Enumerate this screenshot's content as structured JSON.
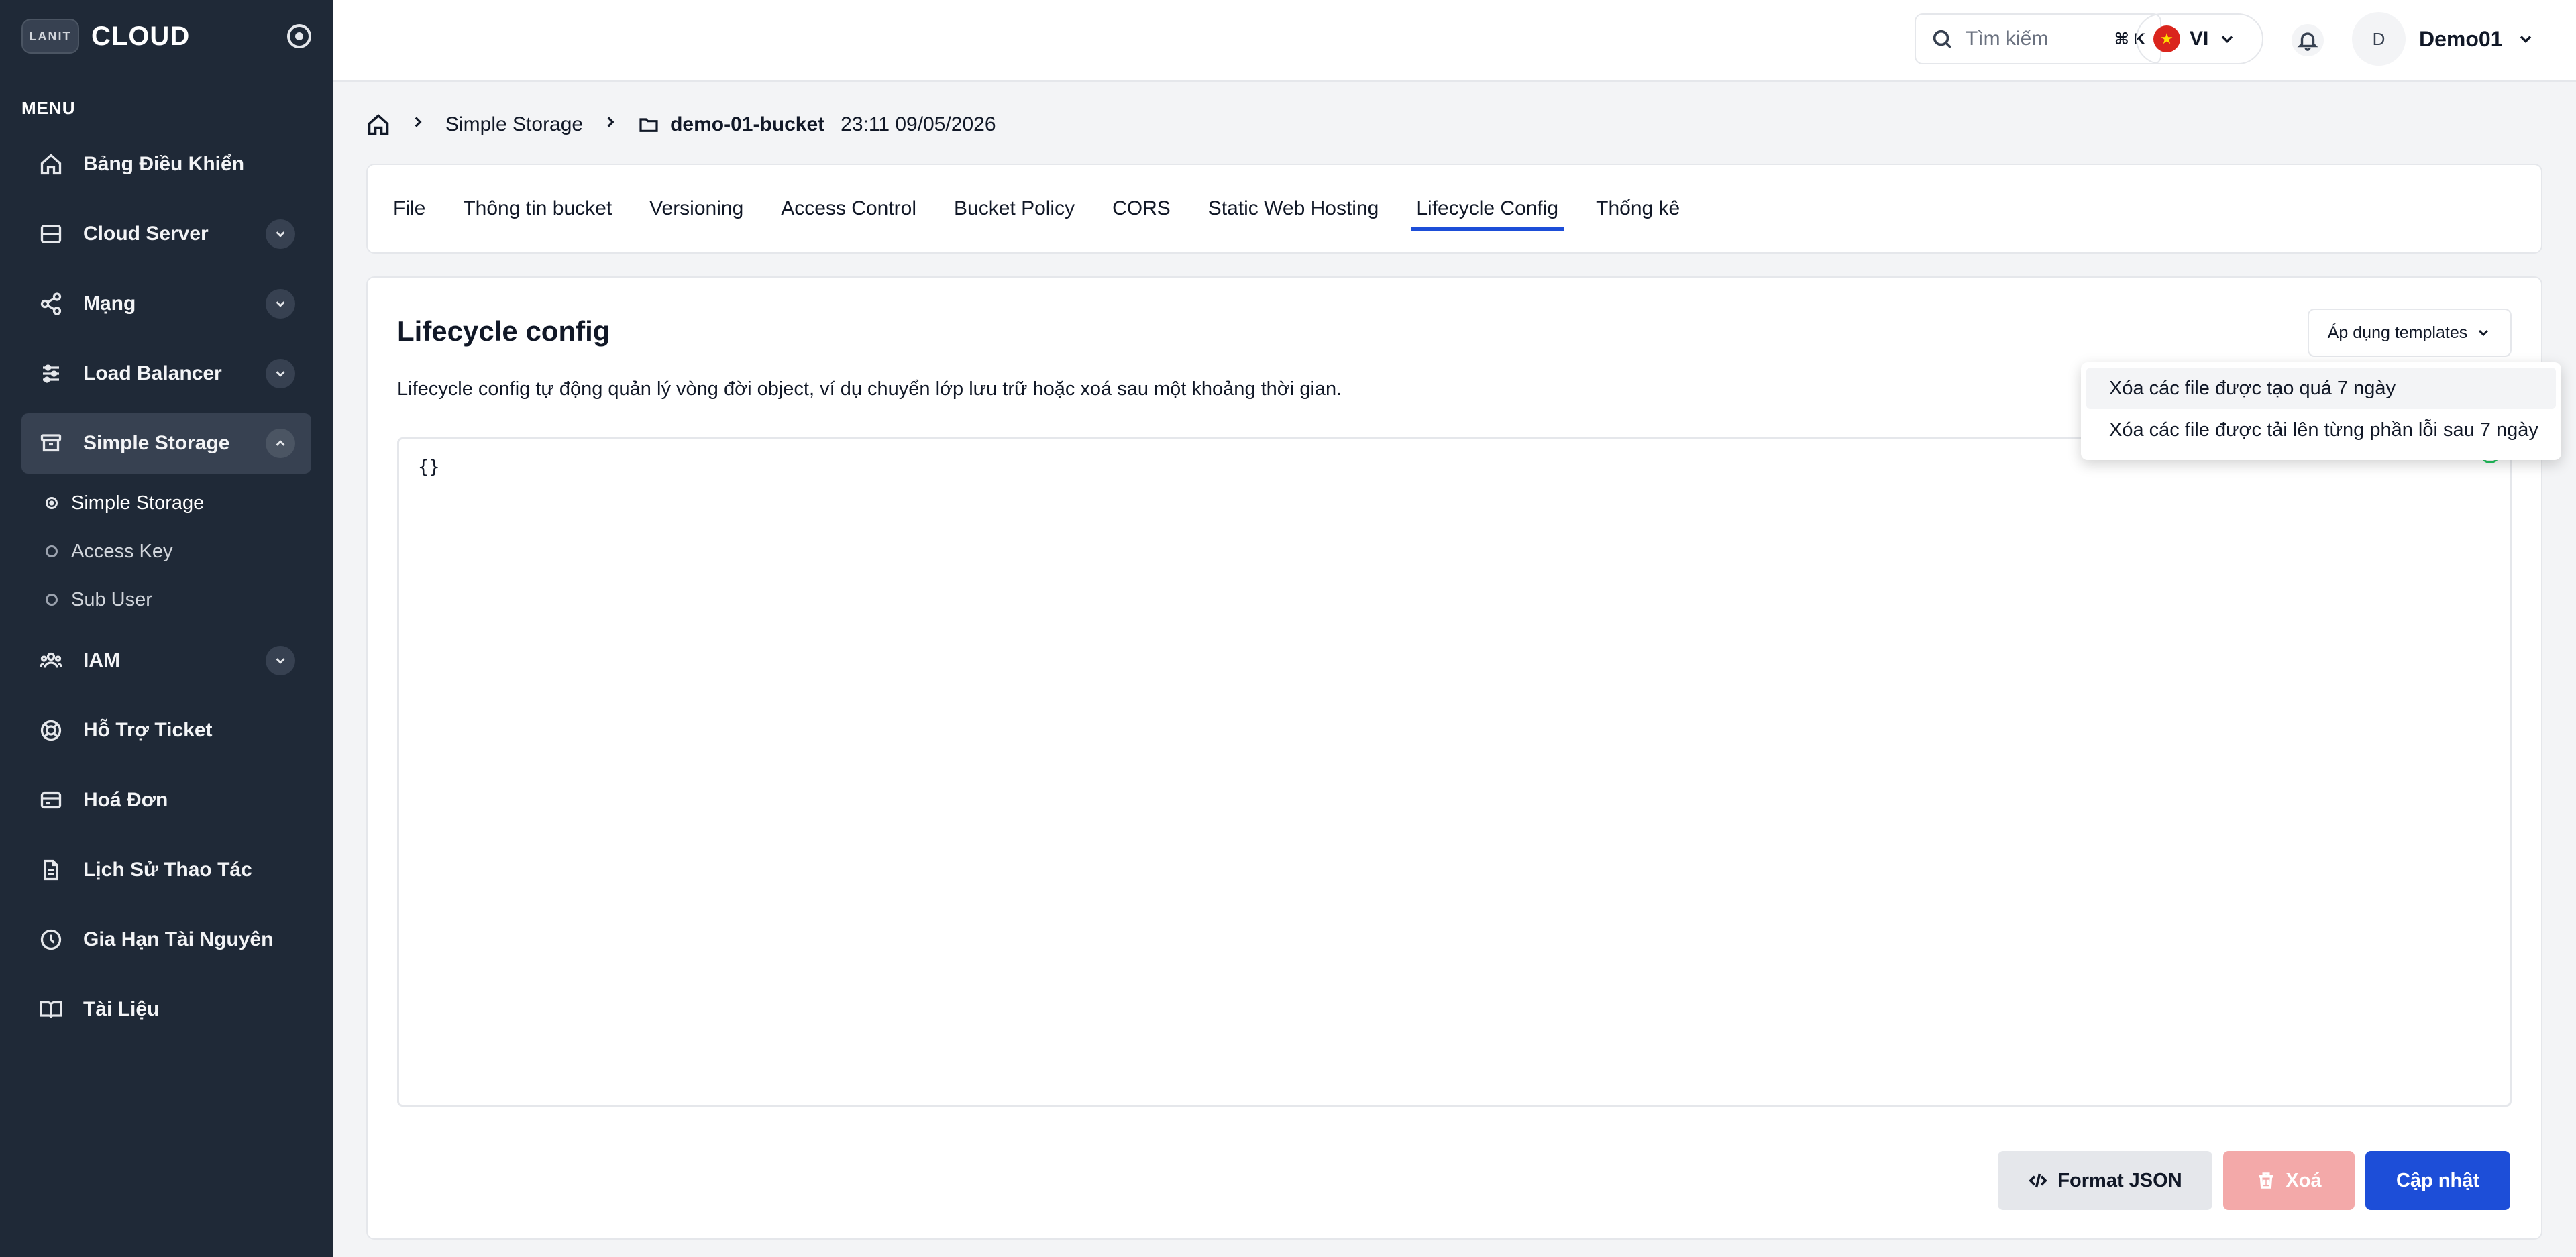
{
  "brand": {
    "logo_text": "LANIT",
    "name": "CLOUD"
  },
  "sidebar": {
    "menu_label": "MENU",
    "items": [
      {
        "label": "Bảng Điều Khiển",
        "icon": "home-icon",
        "has_chevron": false
      },
      {
        "label": "Cloud Server",
        "icon": "server-icon",
        "has_chevron": true
      },
      {
        "label": "Mạng",
        "icon": "share-icon",
        "has_chevron": true
      },
      {
        "label": "Load Balancer",
        "icon": "sliders-icon",
        "has_chevron": true
      },
      {
        "label": "Simple Storage",
        "icon": "archive-icon",
        "has_chevron": true,
        "expanded": true
      },
      {
        "label": "IAM",
        "icon": "users-icon",
        "has_chevron": true
      },
      {
        "label": "Hỗ Trợ Ticket",
        "icon": "lifebuoy-icon",
        "has_chevron": false
      },
      {
        "label": "Hoá Đơn",
        "icon": "credit-card-icon",
        "has_chevron": false
      },
      {
        "label": "Lịch Sử Thao Tác",
        "icon": "document-icon",
        "has_chevron": false
      },
      {
        "label": "Gia Hạn Tài Nguyên",
        "icon": "clock-icon",
        "has_chevron": false
      },
      {
        "label": "Tài Liệu",
        "icon": "book-icon",
        "has_chevron": false
      }
    ],
    "storage_sub": [
      {
        "label": "Simple Storage",
        "active": true
      },
      {
        "label": "Access Key",
        "active": false
      },
      {
        "label": "Sub User",
        "active": false
      }
    ]
  },
  "header": {
    "search_placeholder": "Tìm kiếm",
    "search_shortcut": "⌘ K",
    "language": "VI",
    "user_initial": "D",
    "username": "Demo01"
  },
  "breadcrumb": {
    "service": "Simple Storage",
    "bucket": "demo-01-bucket",
    "timestamp": "23:11 09/05/2026"
  },
  "tabs": [
    {
      "label": "File",
      "active": false
    },
    {
      "label": "Thông tin bucket",
      "active": false
    },
    {
      "label": "Versioning",
      "active": false
    },
    {
      "label": "Access Control",
      "active": false
    },
    {
      "label": "Bucket Policy",
      "active": false
    },
    {
      "label": "CORS",
      "active": false
    },
    {
      "label": "Static Web Hosting",
      "active": false
    },
    {
      "label": "Lifecycle Config",
      "active": true
    },
    {
      "label": "Thống kê",
      "active": false
    }
  ],
  "lifecycle": {
    "title": "Lifecycle config",
    "description": "Lifecycle config tự động quản lý vòng đời object, ví dụ chuyển lớp lưu trữ hoặc xoá sau một khoảng thời gian.",
    "templates_button": "Áp dụng templates",
    "editor_value": "{}",
    "templates": [
      "Xóa các file được tạo quá 7 ngày",
      "Xóa các file được tải lên từng phần lỗi sau 7 ngày"
    ],
    "buttons": {
      "format": "Format JSON",
      "delete": "Xoá",
      "update": "Cập nhật"
    }
  },
  "colors": {
    "sidebar_bg": "#1f2937",
    "accent": "#1d4ed8",
    "delete_disabled": "#f3a9a9"
  }
}
